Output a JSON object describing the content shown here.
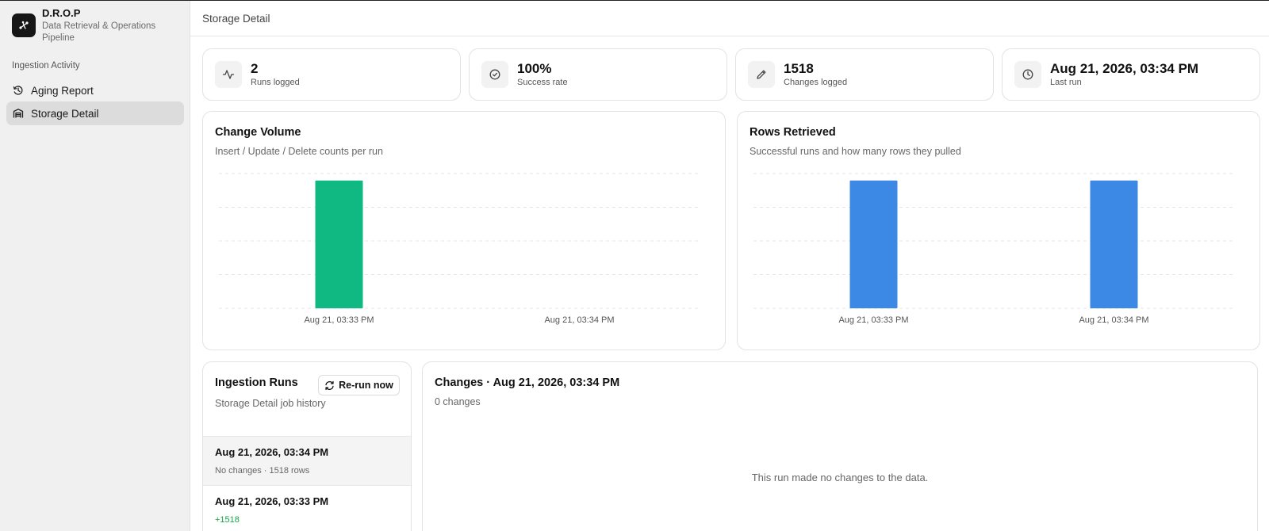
{
  "brand": {
    "name": "D.R.O.P",
    "subtitle": "Data Retrieval & Operations Pipeline"
  },
  "sidebar": {
    "section_label": "Ingestion Activity",
    "items": [
      {
        "label": "Aging Report",
        "icon": "history-icon",
        "active": false
      },
      {
        "label": "Storage Detail",
        "icon": "warehouse-icon",
        "active": true
      }
    ]
  },
  "header": {
    "title": "Storage Detail"
  },
  "stats": [
    {
      "value": "2",
      "label": "Runs logged",
      "icon": "activity-icon"
    },
    {
      "value": "100%",
      "label": "Success rate",
      "icon": "check-circle-icon"
    },
    {
      "value": "1518",
      "label": "Changes logged",
      "icon": "pencil-icon"
    },
    {
      "value": "Aug 21, 2026, 03:34 PM",
      "label": "Last run",
      "icon": "clock-icon"
    }
  ],
  "change_volume": {
    "title": "Change Volume",
    "subtitle": "Insert / Update / Delete counts per run"
  },
  "rows_retrieved": {
    "title": "Rows Retrieved",
    "subtitle": "Successful runs and how many rows they pulled"
  },
  "chart_data": [
    {
      "type": "bar",
      "title": "Change Volume",
      "categories": [
        "Aug 21, 03:33 PM",
        "Aug 21, 03:34 PM"
      ],
      "series": [
        {
          "values": [
            1518,
            0
          ],
          "color": "#10b981"
        }
      ],
      "ylim": [
        0,
        1600
      ],
      "grid": true
    },
    {
      "type": "bar",
      "title": "Rows Retrieved",
      "categories": [
        "Aug 21, 03:33 PM",
        "Aug 21, 03:34 PM"
      ],
      "series": [
        {
          "values": [
            1518,
            1518
          ],
          "color": "#3b88e5"
        }
      ],
      "ylim": [
        0,
        1600
      ],
      "grid": true
    }
  ],
  "runs": {
    "title": "Ingestion Runs",
    "subtitle": "Storage Detail job history",
    "rerun_label": "Re-run now",
    "items": [
      {
        "title": "Aug 21, 2026, 03:34 PM",
        "meta": "No changes · 1518 rows",
        "selected": true
      },
      {
        "title": "Aug 21, 2026, 03:33 PM",
        "meta": "+1518",
        "selected": false
      }
    ]
  },
  "changes": {
    "title": "Changes · Aug 21, 2026, 03:34 PM",
    "subtitle": "0 changes",
    "empty_message": "This run made no changes to the data."
  }
}
